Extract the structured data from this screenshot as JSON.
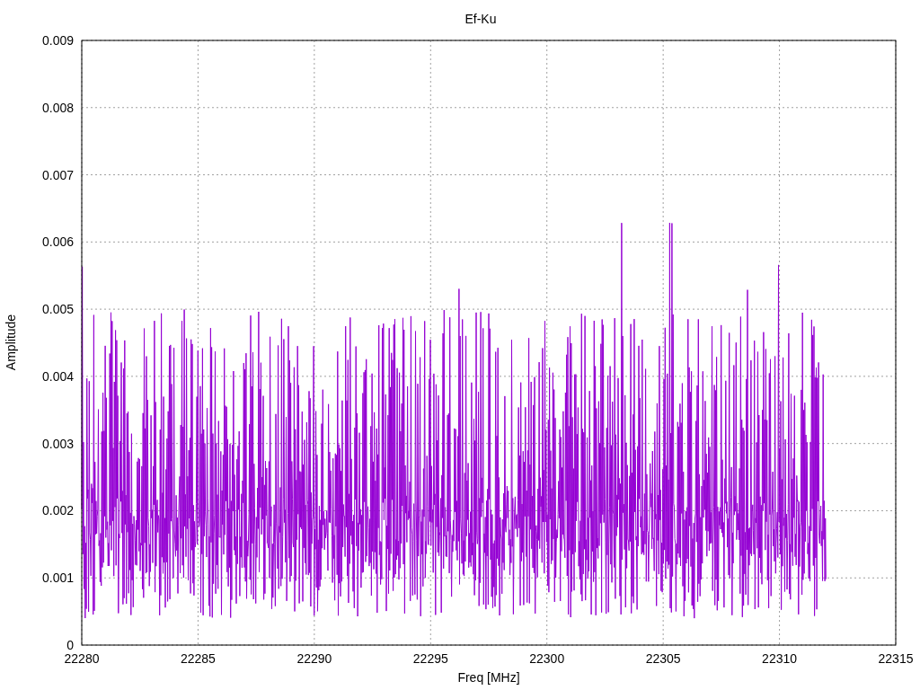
{
  "chart": {
    "title": "Ef-Ku",
    "xlabel": "Freq [MHz]",
    "ylabel": "Amplitude",
    "xticks": [
      "22280",
      "22285",
      "22290",
      "22295",
      "22300",
      "22305",
      "22310",
      "22315"
    ],
    "yticks": [
      "0.009",
      "0.008",
      "0.007",
      "0.006",
      "0.005",
      "0.004",
      "0.003",
      "0.002",
      "0.001",
      "0"
    ]
  }
}
